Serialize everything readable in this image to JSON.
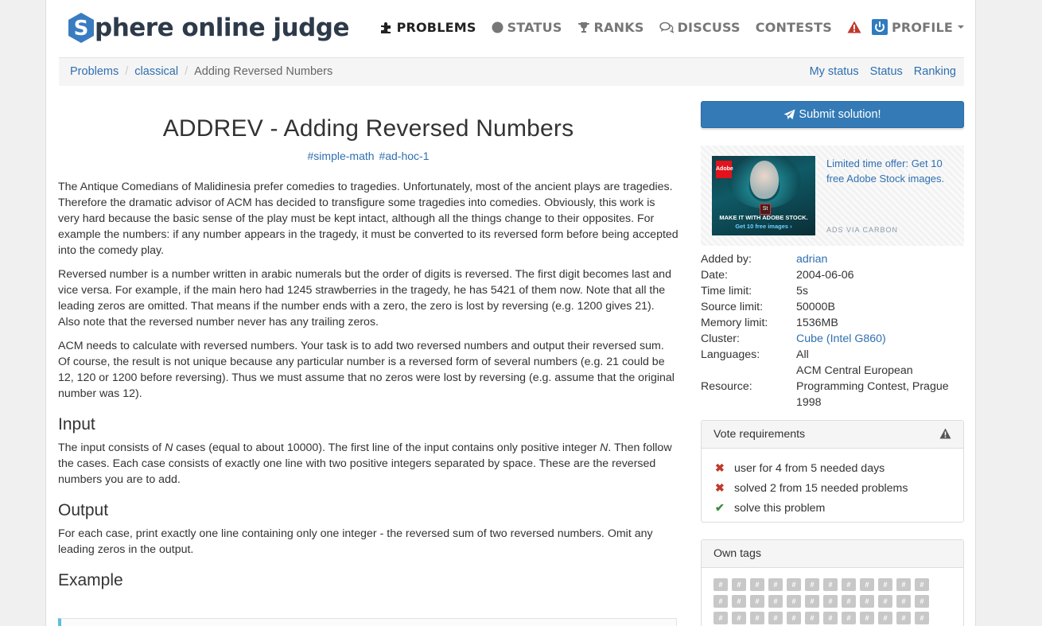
{
  "brand": {
    "logo_letter": "S",
    "name": "phere online judge"
  },
  "nav": {
    "problems": "PROBLEMS",
    "status": "STATUS",
    "ranks": "RANKS",
    "discuss": "DISCUSS",
    "contests": "CONTESTS",
    "profile": "PROFILE"
  },
  "breadcrumb": {
    "items": [
      "Problems",
      "classical",
      "Adding Reversed Numbers"
    ],
    "right_links": [
      "My status",
      "Status",
      "Ranking"
    ]
  },
  "problem": {
    "title": "ADDREV - Adding Reversed Numbers",
    "tags": [
      "#simple-math",
      "#ad-hoc-1"
    ],
    "paragraphs": [
      "The Antique Comedians of Malidinesia prefer comedies to tragedies. Unfortunately, most of the ancient plays are tragedies. Therefore the dramatic advisor of ACM has decided to transfigure some tragedies into comedies. Obviously, this work is very hard because the basic sense of the play must be kept intact, although all the things change to their opposites. For example the numbers: if any number appears in the tragedy, it must be converted to its reversed form before being accepted into the comedy play.",
      "Reversed number is a number written in arabic numerals but the order of digits is reversed. The first digit becomes last and vice versa. For example, if the main hero had 1245 strawberries in the tragedy, he has 5421 of them now. Note that all the leading zeros are omitted. That means if the number ends with a zero, the zero is lost by reversing (e.g. 1200 gives 21). Also note that the reversed number never has any trailing zeros.",
      "ACM needs to calculate with reversed numbers. Your task is to add two reversed numbers and output their reversed sum. Of course, the result is not unique because any particular number is a reversed form of several numbers (e.g. 21 could be 12, 120 or 1200 before reversing). Thus we must assume that no zeros were lost by reversing (e.g. assume that the original number was 12)."
    ],
    "input_heading": "Input",
    "input_text": {
      "a": "The input consists of ",
      "n1": "N",
      "b": " cases (equal to about 10000). The first line of the input contains only positive integer ",
      "n2": "N",
      "c": ". Then follow the cases. Each case consists of exactly one line with two positive integers separated by space. These are the reversed numbers you are to add."
    },
    "output_heading": "Output",
    "output_text": "For each case, print exactly one line containing only one integer - the reversed sum of two reversed numbers. Omit any leading zeros in the output.",
    "example_heading": "Example"
  },
  "sidebar": {
    "submit_label": "Submit solution!",
    "ad": {
      "text": "Limited time offer: Get 10 free Adobe Stock images.",
      "via": "ADS VIA CARBON",
      "image_brand": "Adobe",
      "image_badge": "St",
      "image_caption_1": "MAKE IT WITH ADOBE STOCK.",
      "image_caption_2": "Get 10 free images ›"
    },
    "info": [
      {
        "k": "Added by:",
        "v": "adrian",
        "link": true
      },
      {
        "k": "Date:",
        "v": "2004-06-06",
        "link": false
      },
      {
        "k": "Time limit:",
        "v": "5s",
        "link": false
      },
      {
        "k": "Source limit:",
        "v": "50000B",
        "link": false
      },
      {
        "k": "Memory limit:",
        "v": "1536MB",
        "link": false
      },
      {
        "k": "Cluster:",
        "v": "Cube (Intel G860)",
        "link": true
      },
      {
        "k": "Languages:",
        "v": "All",
        "link": false
      },
      {
        "k": "",
        "v": "ACM Central European",
        "link": false
      },
      {
        "k": "Resource:",
        "v": "Programming Contest, Prague 1998",
        "link": false
      }
    ],
    "vote": {
      "title": "Vote requirements",
      "items": [
        {
          "ok": false,
          "text": "user for 4 from 5 needed days"
        },
        {
          "ok": false,
          "text": "solved 2 from 15 needed problems"
        },
        {
          "ok": true,
          "text": "solve this problem"
        }
      ]
    },
    "own_tags": {
      "title": "Own tags",
      "tag_symbol": "#"
    }
  },
  "colors": {
    "link": "#2f6fb0",
    "submit": "#337ab7",
    "error": "#c0392b",
    "ok": "#3c8d3c"
  }
}
